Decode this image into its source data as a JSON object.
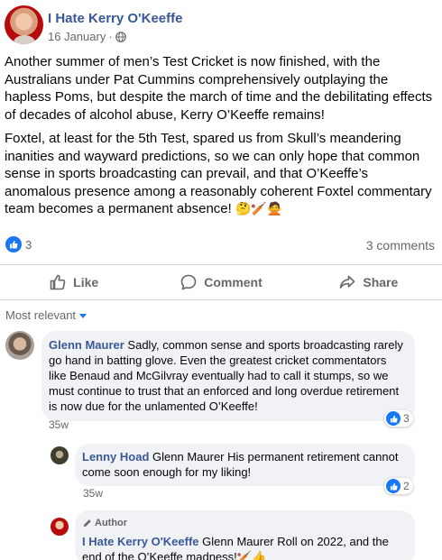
{
  "post": {
    "page_name": "I Hate Kerry O'Keeffe",
    "date": "16 January",
    "separator": "·",
    "privacy_icon": "globe-icon",
    "paragraphs": [
      "Another summer of men’s Test Cricket is now finished, with the Australians under Pat Cummins comprehensively outplaying the hapless Poms, but despite the march of time and the debilitating effects of decades of alcohol abuse, Kerry O’Keeffe remains!",
      "Foxtel, at least for the 5th Test, spared us from Skull’s meandering inanities and wayward predictions, so we can only hope that common sense in sports broadcasting can prevail, and that O’Keeffe’s anomalous presence among a reasonably coherent Foxtel commentary team becomes a permanent absence!"
    ],
    "end_emojis": "🤔🏏🙅"
  },
  "stats": {
    "like_count": "3",
    "comments_label": "3 comments"
  },
  "actions": {
    "like": "Like",
    "comment": "Comment",
    "share": "Share"
  },
  "sort_label": "Most relevant",
  "comments": [
    {
      "name": "Glenn Maurer",
      "text": "Sadly, common sense and sports broadcasting rarely go hand in batting glove. Even the greatest cricket commentators like Benaud and McGilvray eventually had to call it stumps, so we must continue to trust that an enforced and long overdue retirement is now due for the unlamented O’Keeffe!",
      "time": "35w",
      "reactions": "3"
    },
    {
      "name": "Lenny Hoad",
      "text": "Glenn Maurer His permanent retirement cannot come soon enough for my liking!",
      "time": "35w",
      "reactions": "2"
    },
    {
      "author_tag": "Author",
      "name": "I Hate Kerry O'Keeffe",
      "text": "Glenn Maurer Roll on 2022, and the end of the O’Keeffe madness!🏏👍"
    }
  ],
  "colors": {
    "link": "#385898",
    "accent": "#1877f2",
    "muted": "#65676b",
    "bubble": "#f0f2f5"
  }
}
